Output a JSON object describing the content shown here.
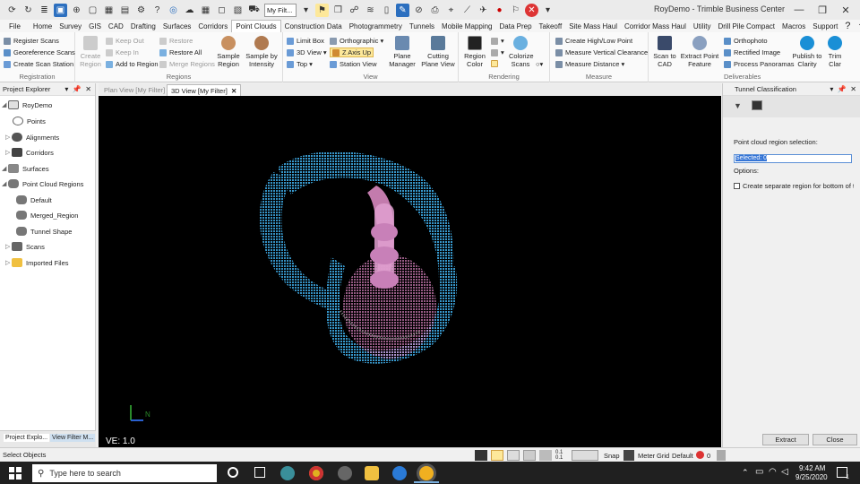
{
  "window": {
    "title": "RoyDemo - Trimble Business Center",
    "filter_dropdown": "My Filt...",
    "minimize": "—",
    "maximize": "❐",
    "close": "✕"
  },
  "menu": [
    "File",
    "Home",
    "Survey",
    "GIS",
    "CAD",
    "Drafting",
    "Surfaces",
    "Corridors",
    "Point Clouds",
    "Construction Data",
    "Photogrammetry",
    "Tunnels",
    "Mobile Mapping",
    "Data Prep",
    "Takeoff",
    "Site Mass Haul",
    "Corridor Mass Haul",
    "Utility",
    "Drill Pile Compact",
    "Macros",
    "Support"
  ],
  "ribbon": {
    "registration": {
      "label": "Registration",
      "items": [
        "Register Scans",
        "Georeference Scans",
        "Create Scan Station"
      ]
    },
    "regions": {
      "label": "Regions",
      "create_region": "Create Region",
      "col1": [
        "Keep Out",
        "Keep In",
        "Add to Region"
      ],
      "col2": [
        "Restore",
        "Restore All",
        "Merge Regions"
      ],
      "sample_region": "Sample Region",
      "sample_by_intensity": "Sample by Intensity"
    },
    "view": {
      "label": "View",
      "col1": [
        "Limit Box",
        "3D View",
        "Top"
      ],
      "col2": [
        "Orthographic",
        "Z Axis Up",
        "Station View"
      ],
      "plane_manager": "Plane Manager",
      "cutting_plane_view": "Cutting Plane View"
    },
    "rendering": {
      "label": "Rendering",
      "region_color": "Region Color",
      "colorize_scans": "Colorize Scans"
    },
    "measure": {
      "label": "Measure",
      "items": [
        "Create High/Low Point",
        "Measure Vertical Clearance",
        "Measure Distance"
      ]
    },
    "deliverables": {
      "label": "Deliverables",
      "scan_to_cad": "Scan to CAD",
      "extract_point_feature": "Extract Point Feature",
      "items": [
        "Orthophoto",
        "Rectified Image",
        "Process Panoramas"
      ],
      "publish_to_clarity": "Publish to Clarity",
      "trim_clar": "Trim Clar"
    }
  },
  "project_explorer": {
    "title": "Project Explorer",
    "tree": [
      "RoyDemo",
      "Points",
      "Alignments",
      "Corridors",
      "Surfaces",
      "Point Cloud Regions",
      "Default",
      "Merged_Region",
      "Tunnel Shape",
      "Scans",
      "Imported Files"
    ],
    "tabs": [
      "Project Explo...",
      "View Filter M..."
    ]
  },
  "doc_tabs": [
    "Plan View [My Filter]",
    "3D View [My Filter]"
  ],
  "view3d": {
    "ve_label": "VE: 1.0",
    "axis_n": "N"
  },
  "tunnel_panel": {
    "title": "Tunnel Classification",
    "region_label": "Point cloud region selection:",
    "selected_value": "Selected: 0",
    "options_label": "Options:",
    "checkbox_label": "Create separate region for bottom of tunnel",
    "extract": "Extract",
    "close": "Close"
  },
  "status": {
    "left": "Select Objects",
    "snap": "Snap",
    "meter": "Meter",
    "grid": "Grid",
    "default": "Default",
    "count": "0"
  },
  "taskbar": {
    "search_placeholder": "Type here to search",
    "time": "9:42 AM",
    "date": "9/25/2020",
    "notif_count": "1"
  },
  "colors": {
    "tunnel_blue": "#3a9fd6",
    "tunnel_pink": "#e58bc9",
    "ribbon_active": "#fde89a"
  }
}
